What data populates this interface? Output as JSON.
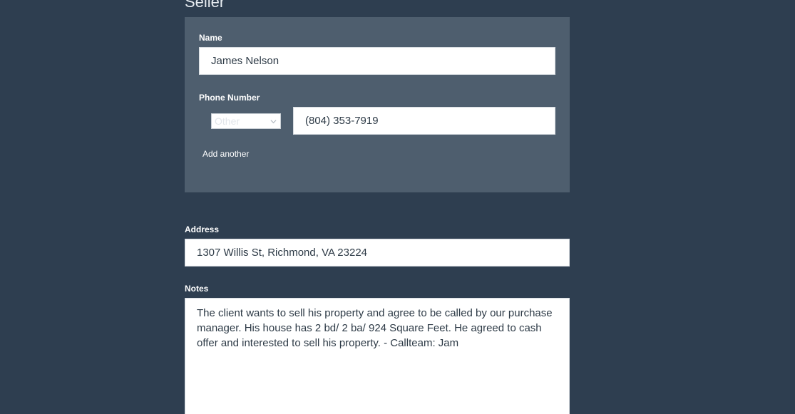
{
  "section": {
    "title": "Seller"
  },
  "seller": {
    "name_label": "Name",
    "name_value": "James Nelson",
    "phone_label": "Phone Number",
    "phone_type": "Other",
    "phone_value": "(804) 353-7919",
    "add_another": "Add another"
  },
  "address": {
    "label": "Address",
    "value": "1307 Willis St, Richmond, VA 23224"
  },
  "notes": {
    "label": "Notes",
    "value": "The client wants to sell his property and agree to be called by our purchase manager. His house has 2 bd/ 2 ba/ 924 Square Feet. He agreed to cash offer and interested to sell his property. - Callteam: Jam"
  },
  "icons": {
    "phone_type_toggle": "chevron-down-icon"
  },
  "colors": {
    "background": "#2e3e50",
    "panel": "#4e5e6e",
    "input_bg": "#ffffff",
    "label": "#ffffff"
  }
}
